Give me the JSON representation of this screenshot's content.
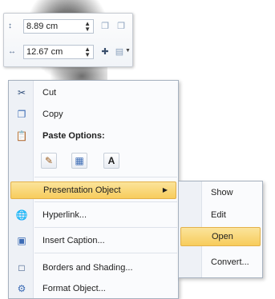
{
  "mini_toolbar": {
    "height_value": "8.89 cm",
    "width_value": "12.67 cm"
  },
  "context_menu": {
    "items": [
      {
        "label": "Cut",
        "icon": "scissors-icon"
      },
      {
        "label": "Copy",
        "icon": "copy-icon"
      },
      {
        "label": "Paste Options:",
        "icon": "clipboard-icon"
      },
      {
        "label": "Presentation Object",
        "icon": ""
      },
      {
        "label": "Hyperlink...",
        "icon": "hyperlink-icon"
      },
      {
        "label": "Insert Caption...",
        "icon": "caption-icon"
      },
      {
        "label": "Borders and Shading...",
        "icon": "borders-icon"
      },
      {
        "label": "Format Object...",
        "icon": "format-object-icon"
      }
    ],
    "paste_buttons": [
      "A"
    ]
  },
  "submenu": {
    "items": [
      {
        "label": "Show"
      },
      {
        "label": "Edit"
      },
      {
        "label": "Open"
      },
      {
        "label": "Convert..."
      }
    ]
  },
  "colors": {
    "highlight_top": "#fbe49b",
    "highlight_bottom": "#f7cc5c",
    "menu_border": "#a6b1bf"
  }
}
